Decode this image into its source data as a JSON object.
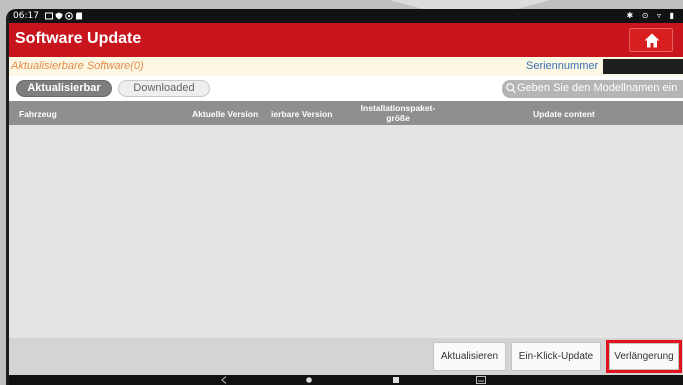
{
  "status": {
    "time": "06:17"
  },
  "header": {
    "title": "Software Update"
  },
  "info": {
    "available_text": "Aktualisierbare Software(0)",
    "serial_label": "Seriennummer"
  },
  "tabs": [
    {
      "label": "Aktualisierbar",
      "active": true
    },
    {
      "label": "Downloaded",
      "active": false
    }
  ],
  "search": {
    "placeholder": "Geben Sie den Modellnamen ein"
  },
  "table": {
    "columns": [
      "Fahrzeug",
      "Aktuelle Version",
      "ierbare Version",
      "Installationspaket-",
      "größe",
      "Update content"
    ],
    "rows": []
  },
  "actions": {
    "update": "Aktualisieren",
    "one_click_update": "Ein-Klick-Update",
    "extension": "Verlängerung"
  },
  "colors": {
    "title_bar": "#c8151d",
    "highlight": "#e0121b",
    "available_text": "#e58b4a",
    "serial_label": "#3a6fb5"
  },
  "icons": [
    "home-icon",
    "search-icon",
    "back-icon",
    "home-nav-icon",
    "recents-icon",
    "keyboard-icon"
  ]
}
